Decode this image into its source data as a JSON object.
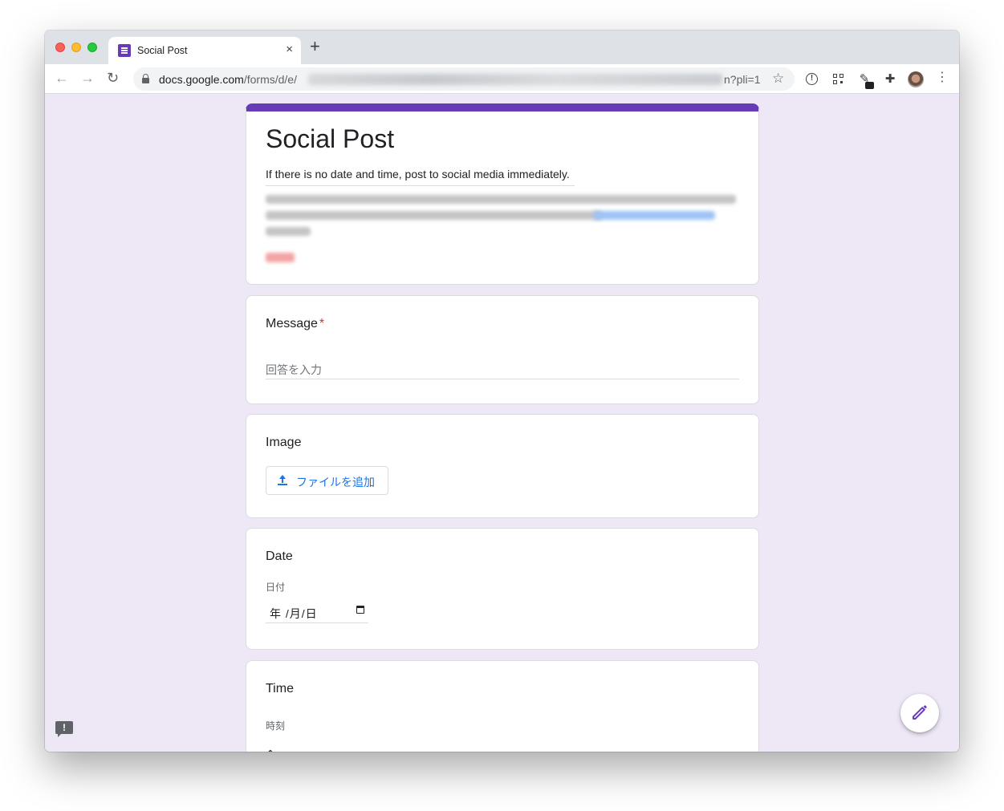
{
  "browser": {
    "tab": {
      "title": "Social Post",
      "close_glyph": "×"
    },
    "new_tab_glyph": "+",
    "url": {
      "host": "docs.google.com",
      "path": "/forms/d/e/",
      "tail": "n?pli=1"
    },
    "icons": [
      "back-icon",
      "forward-icon",
      "reload-icon",
      "lock-icon",
      "star-icon",
      "info-extension-icon",
      "qr-extension-icon",
      "pen-extension-icon",
      "puzzle-extension-icon",
      "avatar",
      "menu-icon"
    ]
  },
  "form": {
    "title": "Social Post",
    "description": "If there is no date and time, post to social media immediately.",
    "accent_color": "#673ab7",
    "background_color": "#ede7f6"
  },
  "questions": {
    "message": {
      "label": "Message",
      "required_mark": "*",
      "placeholder": "回答を入力"
    },
    "image": {
      "label": "Image",
      "upload_label": "ファイルを追加"
    },
    "date": {
      "label": "Date",
      "sub_label": "日付",
      "value": "年 /月/日"
    },
    "time": {
      "label": "Time",
      "sub_label": "時刻"
    }
  },
  "fab": {
    "icon": "edit-pencil-icon"
  },
  "feedback": {
    "glyph": "!"
  }
}
